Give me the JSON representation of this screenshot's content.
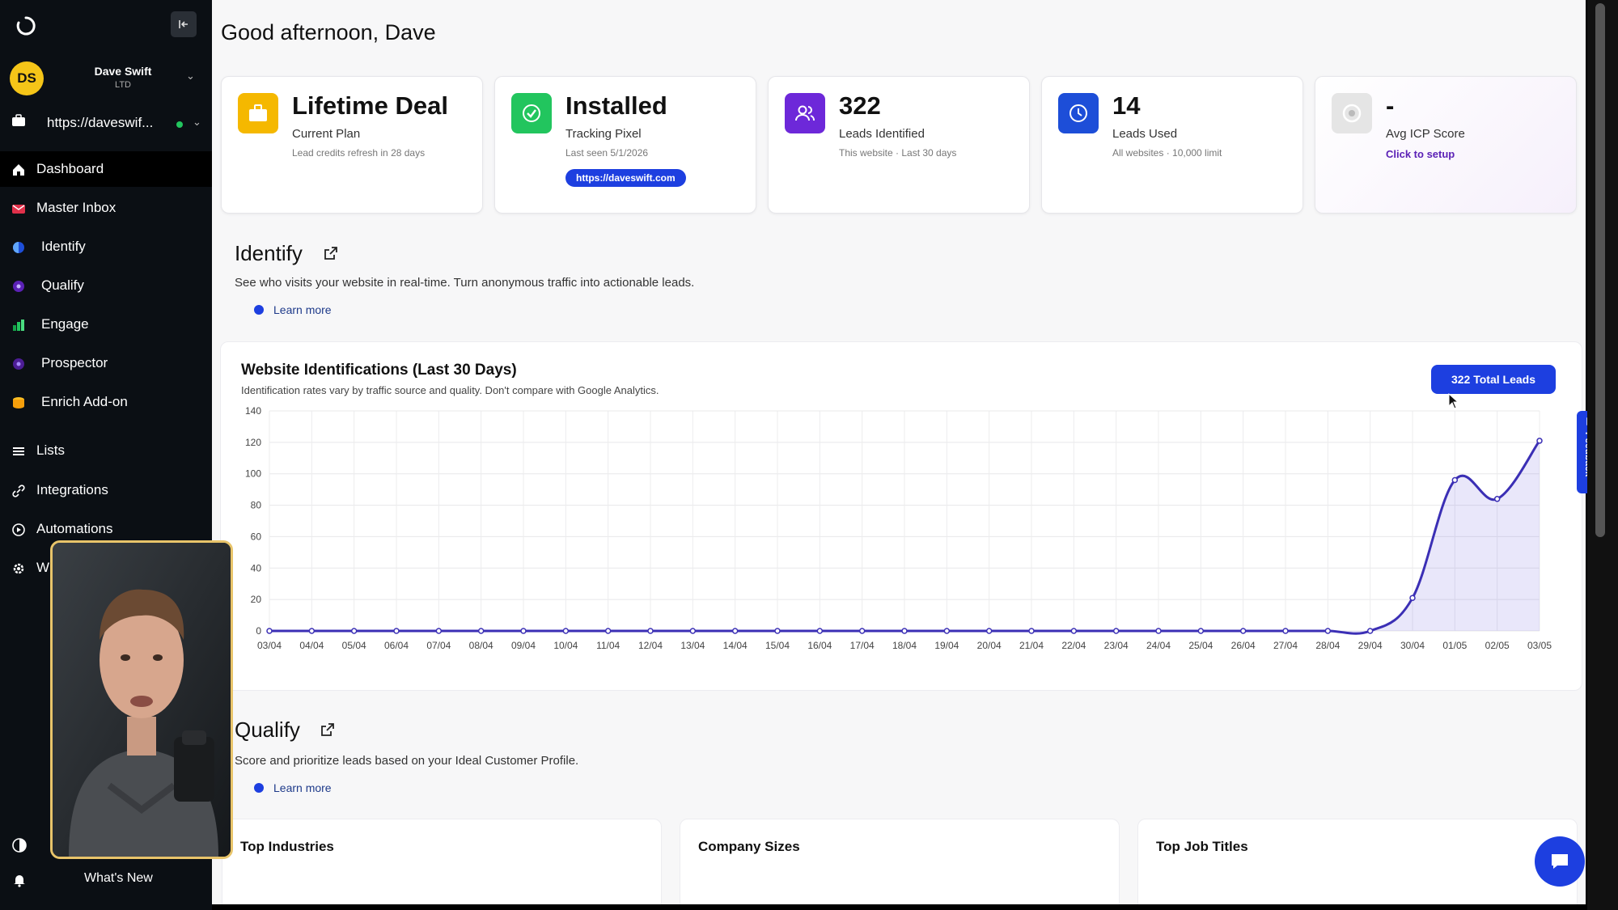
{
  "sidebar": {
    "user": {
      "initials": "DS",
      "name": "Dave Swift",
      "plan": "LTD"
    },
    "site": {
      "url": "https://daveswif..."
    },
    "nav": [
      {
        "label": "Dashboard",
        "icon": "home-icon",
        "active": true
      },
      {
        "label": "Master Inbox",
        "icon": "mail-icon"
      },
      {
        "label": "Identify",
        "icon": "identify-icon"
      },
      {
        "label": "Qualify",
        "icon": "qualify-icon"
      },
      {
        "label": "Engage",
        "icon": "engage-icon"
      },
      {
        "label": "Prospector",
        "icon": "prospector-icon"
      },
      {
        "label": "Enrich Add-on",
        "icon": "enrich-icon"
      },
      {
        "label": "Lists",
        "icon": "list-icon"
      },
      {
        "label": "Integrations",
        "icon": "integrations-icon"
      },
      {
        "label": "Automations",
        "icon": "automations-icon"
      },
      {
        "label": "W",
        "icon": "settings-icon"
      }
    ],
    "whats_new": "What's New"
  },
  "header": {
    "greeting": "Good afternoon, Dave"
  },
  "cards": [
    {
      "value": "Lifetime Deal",
      "label": "Current Plan",
      "sub": "Lead credits refresh in 28 days",
      "icon": "briefcase-icon",
      "color": "#f5b800"
    },
    {
      "value": "Installed",
      "label": "Tracking Pixel",
      "sub": "Last seen 5/1/2026",
      "button": "https://daveswift.com",
      "icon": "check-circle-icon",
      "color": "#22c55e"
    },
    {
      "value": "322",
      "label": "Leads Identified",
      "sub": "This website · Last 30 days",
      "icon": "users-icon",
      "color": "#6d28d9"
    },
    {
      "value": "14",
      "label": "Leads Used",
      "sub": "All websites · 10,000 limit",
      "icon": "clock-icon",
      "color": "#1d4ed8"
    },
    {
      "value": "-",
      "label": "Avg ICP Score",
      "link": "Click to setup",
      "icon": "target-icon",
      "color": "#cccccc"
    }
  ],
  "identify": {
    "title": "Identify",
    "description": "See who visits your website in real-time. Turn anonymous traffic into actionable leads.",
    "learn_more": "Learn more"
  },
  "chart_data": {
    "type": "area",
    "title": "Website Identifications (Last 30 Days)",
    "subtitle": "Identification rates vary by traffic source and quality. Don't compare with Google Analytics.",
    "badge": "322 Total Leads",
    "categories": [
      "03/04",
      "04/04",
      "05/04",
      "06/04",
      "07/04",
      "08/04",
      "09/04",
      "10/04",
      "11/04",
      "12/04",
      "13/04",
      "14/04",
      "15/04",
      "16/04",
      "17/04",
      "18/04",
      "19/04",
      "20/04",
      "21/04",
      "22/04",
      "23/04",
      "24/04",
      "25/04",
      "26/04",
      "27/04",
      "28/04",
      "29/04",
      "30/04",
      "01/05",
      "02/05",
      "03/05"
    ],
    "values": [
      0,
      0,
      0,
      0,
      0,
      0,
      0,
      0,
      0,
      0,
      0,
      0,
      0,
      0,
      0,
      0,
      0,
      0,
      0,
      0,
      0,
      0,
      0,
      0,
      0,
      0,
      0,
      21,
      96,
      84,
      121
    ],
    "ylim": [
      0,
      140
    ],
    "yticks": [
      0,
      20,
      40,
      60,
      80,
      100,
      120,
      140
    ],
    "color": "#3b2fb5",
    "grid": true
  },
  "qualify": {
    "title": "Qualify",
    "description": "Score and prioritize leads based on your Ideal Customer Profile.",
    "learn_more": "Learn more"
  },
  "bottom_cards": [
    "Top Industries",
    "Company Sizes",
    "Top Job Titles"
  ],
  "feedback": "Feedback"
}
